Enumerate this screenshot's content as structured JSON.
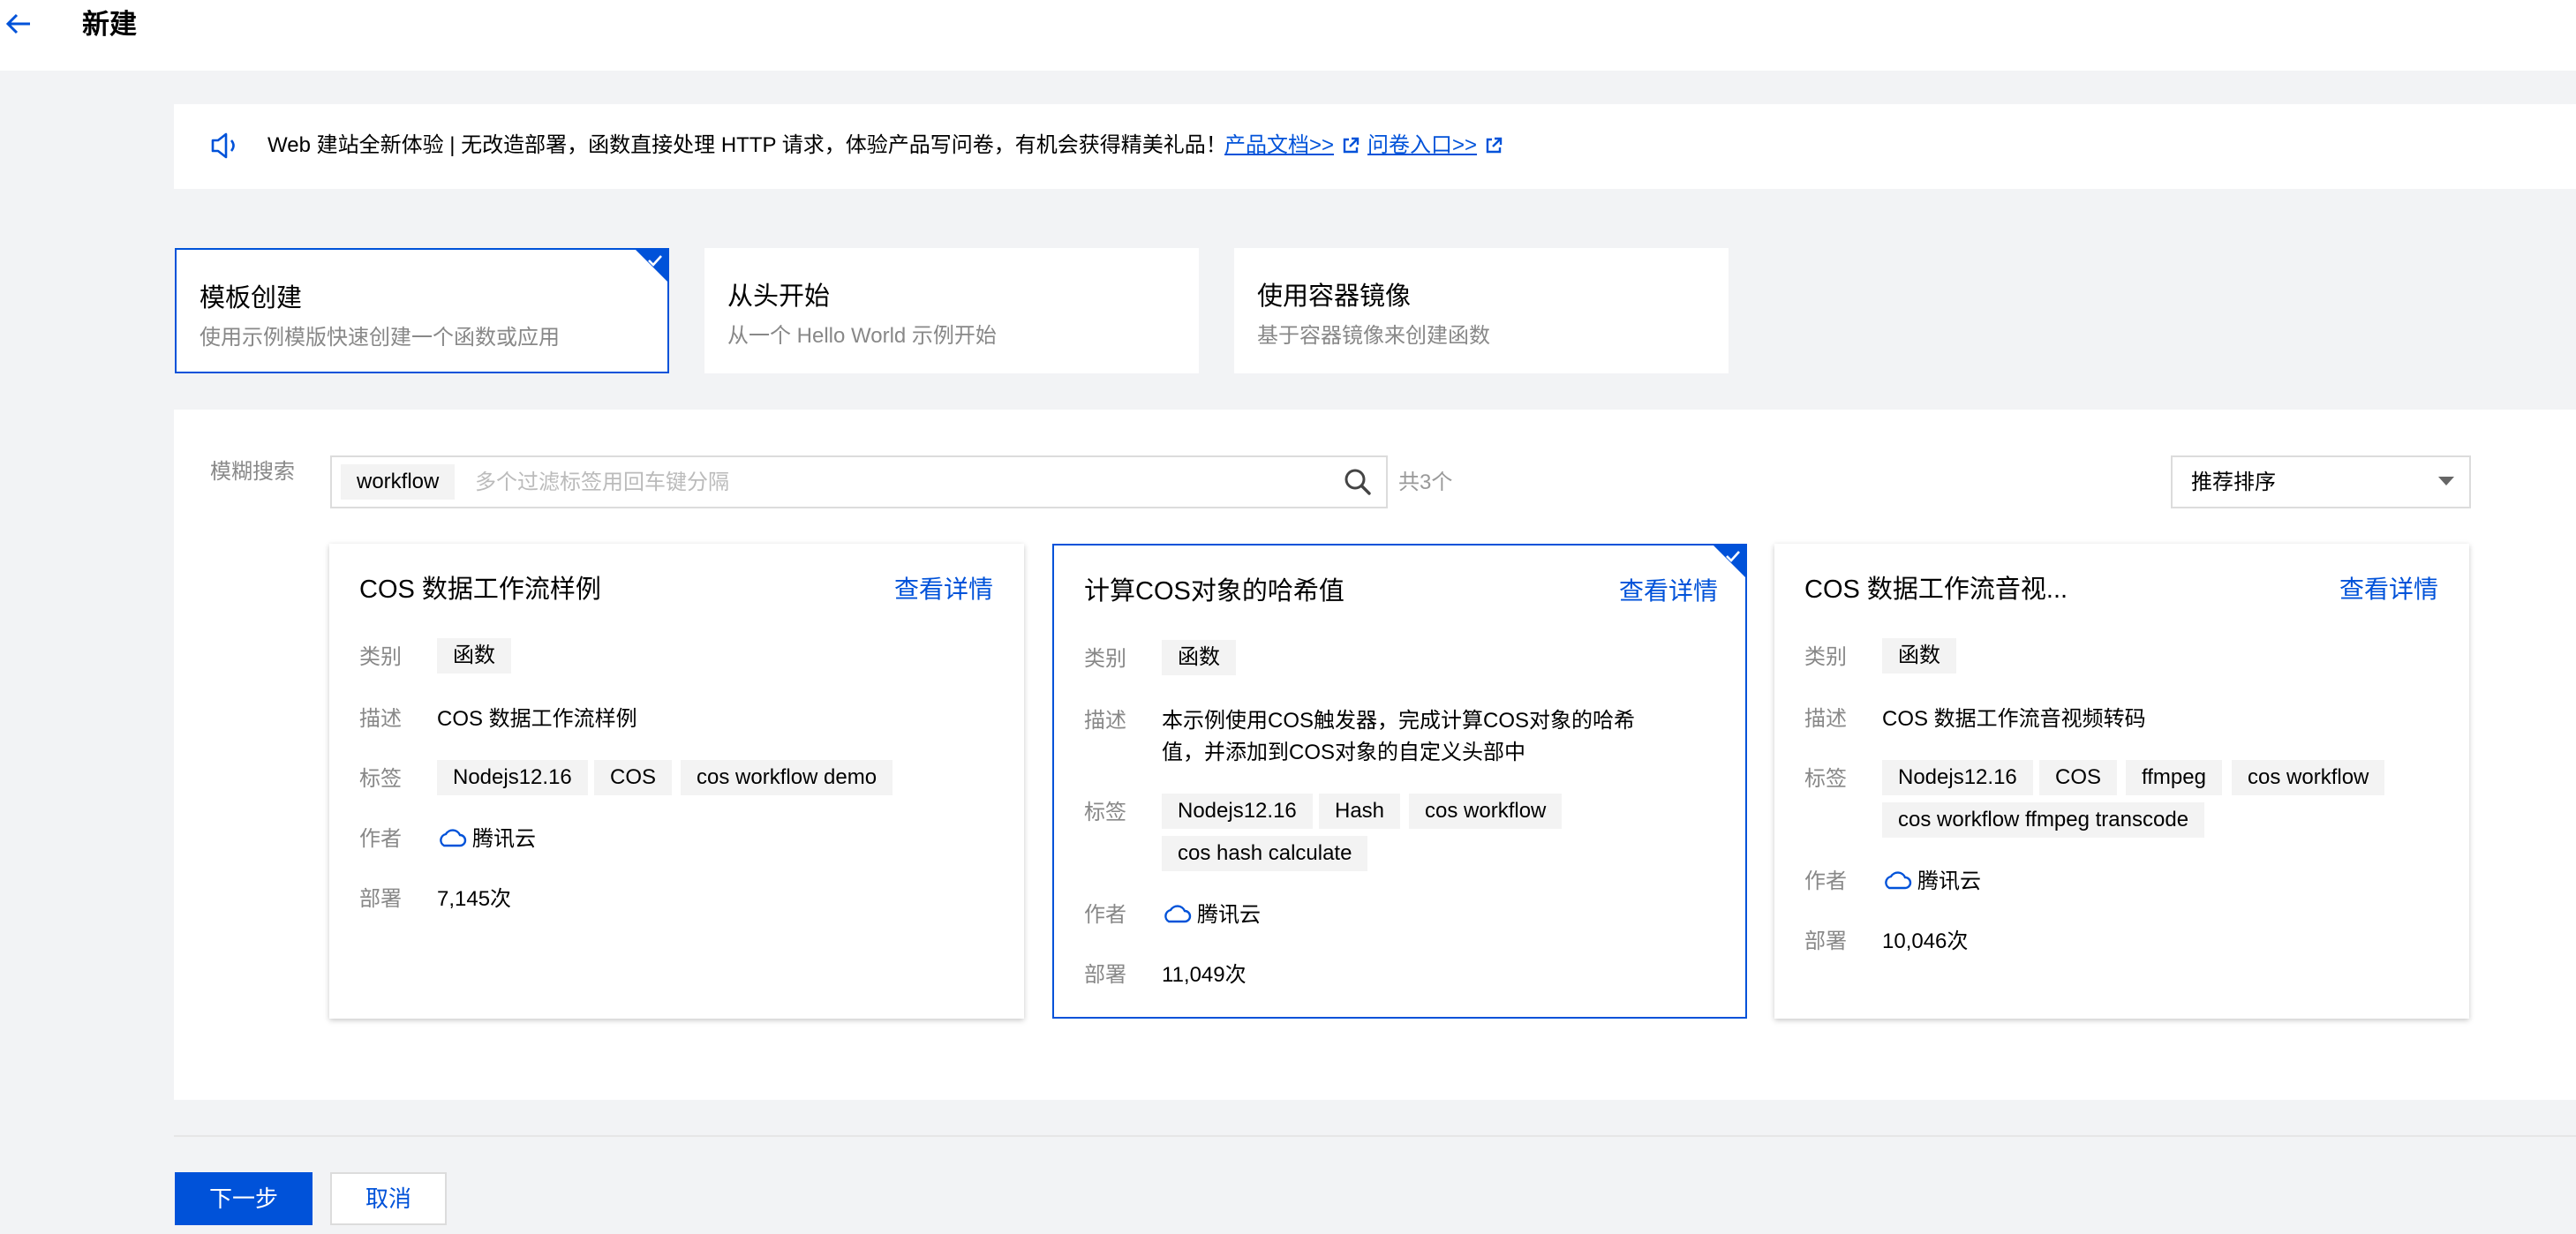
{
  "header": {
    "title": "新建",
    "back_icon": "arrow-left-icon"
  },
  "notice": {
    "text": "Web 建站全新体验 | 无改造部署，函数直接处理 HTTP 请求，体验产品写问卷，有机会获得精美礼品！",
    "doc_link": "产品文档>>",
    "survey_link": "问卷入口>>",
    "icon": "speaker-icon"
  },
  "modes": [
    {
      "title": "模板创建",
      "desc": "使用示例模版快速创建一个函数或应用"
    },
    {
      "title": "从头开始",
      "desc": "从一个 Hello World 示例开始"
    },
    {
      "title": "使用容器镜像",
      "desc": "基于容器镜像来创建函数"
    }
  ],
  "search": {
    "label": "模糊搜索",
    "chip": "workflow",
    "placeholder": "多个过滤标签用回车键分隔",
    "count": "共3个"
  },
  "sort": {
    "selected": "推荐排序"
  },
  "cards": [
    {
      "title": "COS 数据工作流样例",
      "view": "查看详情",
      "category_label": "类别",
      "category": "函数",
      "desc_label": "描述",
      "desc": "COS 数据工作流样例",
      "tags_label": "标签",
      "tags": [
        "Nodejs12.16",
        "COS",
        "cos workflow demo"
      ],
      "author_label": "作者",
      "author": "腾讯云",
      "deploy_label": "部署",
      "deploy": "7,145次"
    },
    {
      "title": "计算COS对象的哈希值",
      "view": "查看详情",
      "category_label": "类别",
      "category": "函数",
      "desc_label": "描述",
      "desc_line1": "本示例使用COS触发器，完成计算COS对象的哈希",
      "desc_line2": "值，并添加到COS对象的自定义头部中",
      "tags_label": "标签",
      "tags": [
        "Nodejs12.16",
        "Hash",
        "cos workflow",
        "cos hash calculate"
      ],
      "author_label": "作者",
      "author": "腾讯云",
      "deploy_label": "部署",
      "deploy": "11,049次"
    },
    {
      "title": "COS 数据工作流音视...",
      "view": "查看详情",
      "category_label": "类别",
      "category": "函数",
      "desc_label": "描述",
      "desc": "COS 数据工作流音视频转码",
      "tags_label": "标签",
      "tags": [
        "Nodejs12.16",
        "COS",
        "ffmpeg",
        "cos workflow",
        "cos workflow ffmpeg transcode"
      ],
      "author_label": "作者",
      "author": "腾讯云",
      "deploy_label": "部署",
      "deploy": "10,046次"
    }
  ],
  "footer": {
    "next": "下一步",
    "cancel": "取消"
  },
  "colors": {
    "accent": "#0052d9",
    "background": "#f2f3f5",
    "tag_bg": "#f3f3f3"
  }
}
